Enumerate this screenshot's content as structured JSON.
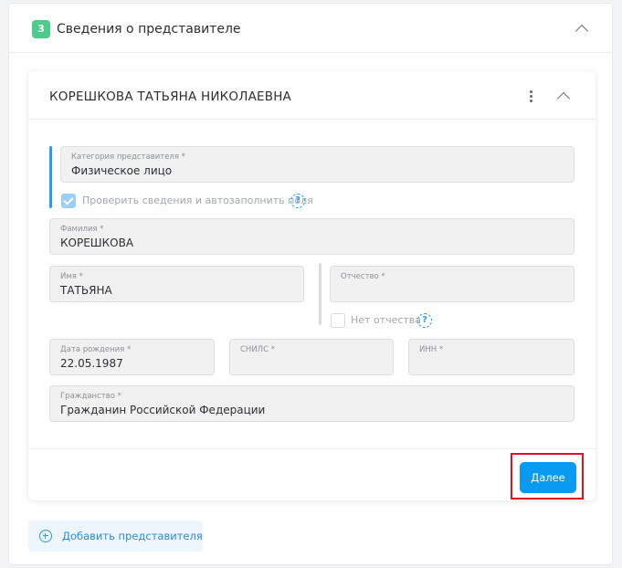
{
  "section": {
    "step_number": "3",
    "title": "Сведения о представителе"
  },
  "representative": {
    "full_name": "КОРЕШКОВА ТАТЬЯНА НИКОЛАЕВНА",
    "category": {
      "label": "Категория представителя *",
      "value": "Физическое лицо"
    },
    "autofill_checkbox": {
      "label": "Проверить сведения и автозаполнить поля",
      "checked": true,
      "help": "?"
    },
    "last_name": {
      "label": "Фамилия *",
      "value": "КОРЕШКОВА"
    },
    "first_name": {
      "label": "Имя *",
      "value": "ТАТЬЯНА"
    },
    "patronymic": {
      "label": "Отчество *",
      "value": ""
    },
    "no_patronymic_checkbox": {
      "label": "Нет отчества",
      "checked": false,
      "help": "?"
    },
    "birth_date": {
      "label": "Дата рождения *",
      "value": "22.05.1987"
    },
    "snils": {
      "label": "СНИЛС *",
      "value": ""
    },
    "inn": {
      "label": "ИНН *",
      "value": ""
    },
    "citizenship": {
      "label": "Гражданство *",
      "value": "Гражданин Российской Федерации"
    }
  },
  "actions": {
    "next_label": "Далее",
    "add_representative_label": "Добавить представителя"
  },
  "colors": {
    "accent": "#0a9bf0",
    "step_badge": "#4ccb8a",
    "highlight": "#e0141e"
  },
  "icons": {
    "section_collapse": "chevron-up-icon",
    "card_menu": "kebab-menu-icon",
    "card_collapse": "chevron-up-icon",
    "help": "question-circle-icon",
    "add": "plus-circle-icon"
  }
}
